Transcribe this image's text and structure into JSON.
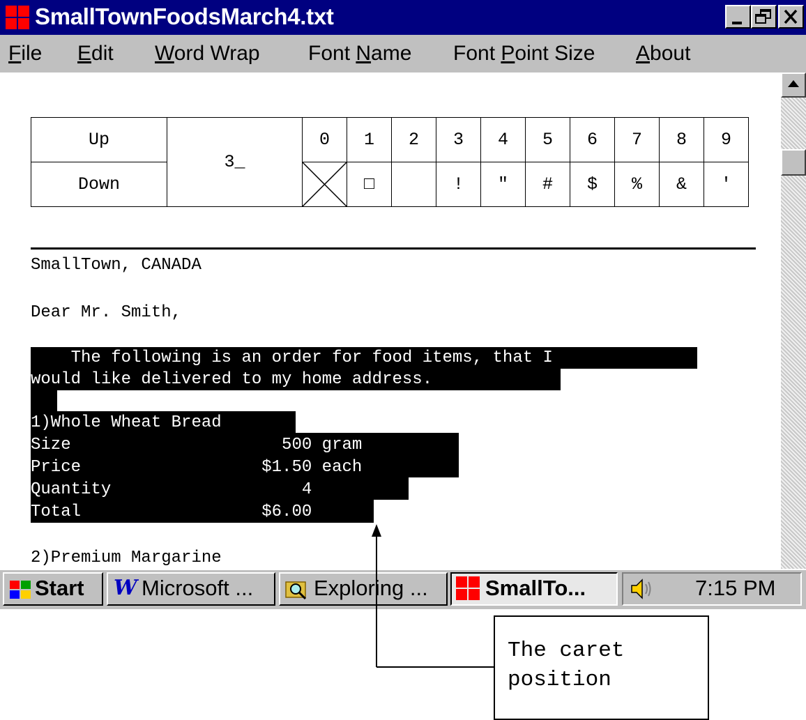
{
  "window": {
    "title": "SmallTownFoodsMarch4.txt"
  },
  "menu": [
    {
      "before": "",
      "key": "F",
      "after": "ile"
    },
    {
      "before": "",
      "key": "E",
      "after": "dit"
    },
    {
      "before": "",
      "key": "W",
      "after": "ord Wrap"
    },
    {
      "before": "Font ",
      "key": "N",
      "after": "ame"
    },
    {
      "before": "Font ",
      "key": "P",
      "after": "oint Size"
    },
    {
      "before": "",
      "key": "A",
      "after": "bout"
    }
  ],
  "char_table": {
    "up_label": "Up",
    "down_label": "Down",
    "row_value": "3_",
    "digits": [
      "0",
      "1",
      "2",
      "3",
      "4",
      "5",
      "6",
      "7",
      "8",
      "9"
    ],
    "down_chars": [
      "",
      "□",
      "",
      "!",
      "\"",
      "#",
      "$",
      "%",
      "&",
      "'"
    ]
  },
  "document": {
    "line_location": "SmallTown, CANADA",
    "line_greeting": "Dear Mr. Smith,",
    "selected_lines": [
      "    The following is an order for food items, that I ",
      "would like delivered to my home address. ",
      "  ",
      "1)Whole Wheat Bread  ",
      "Size                     500 gram ",
      "Price                  $1.50 each ",
      "Quantity                   4  ",
      "Total                  $6.00"
    ],
    "line_next_item": "2)Premium Margarine"
  },
  "taskbar": {
    "start_label": "Start",
    "buttons": [
      {
        "label": "Microsoft ...",
        "icon": "word-icon"
      },
      {
        "label": "Exploring ...",
        "icon": "explorer-icon"
      },
      {
        "label": "SmallTo...",
        "icon": "app-icon"
      }
    ],
    "clock": "7:15 PM"
  },
  "callout": {
    "text": "The caret\nposition"
  },
  "colors": {
    "titlebar": "#000080",
    "chrome": "#c0c0c0",
    "selection": "#000000",
    "icon_red": "#ff0000"
  }
}
